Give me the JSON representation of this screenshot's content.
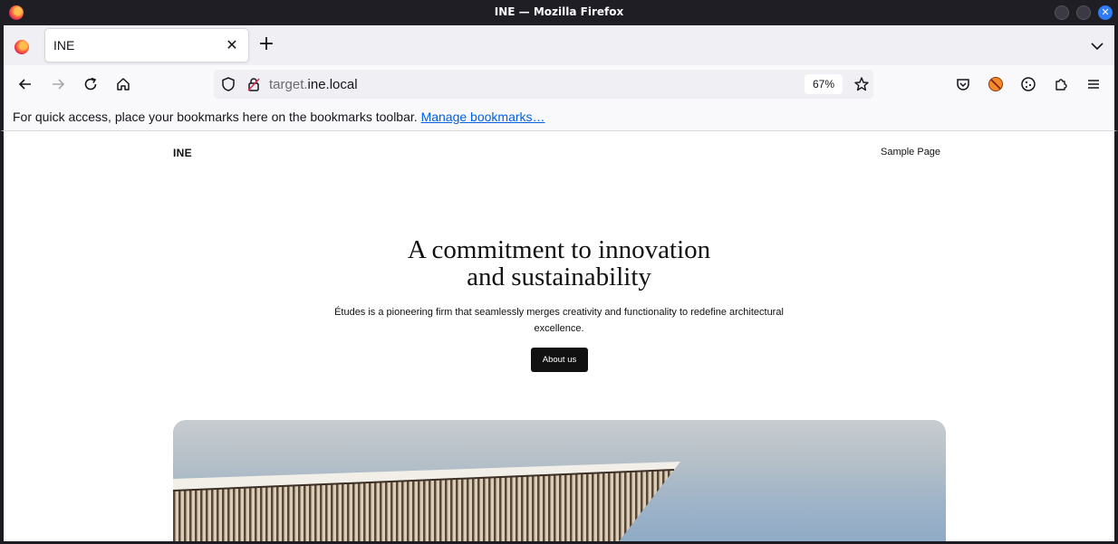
{
  "window": {
    "title": "INE — Mozilla Firefox"
  },
  "tabs": [
    {
      "label": "INE",
      "active": true
    }
  ],
  "toolbar": {
    "url_host_prefix": "target.",
    "url_host_domain": "ine.local",
    "zoom": "67%"
  },
  "bookmarks_bar": {
    "message": "For quick access, place your bookmarks here on the bookmarks toolbar.",
    "manage_link": "Manage bookmarks…"
  },
  "page": {
    "site_title": "INE",
    "nav_link": "Sample Page",
    "hero_title_line1": "A commitment to innovation",
    "hero_title_line2": "and sustainability",
    "hero_description": "Études is a pioneering firm that seamlessly merges creativity and functionality to redefine architectural excellence.",
    "cta_label": "About us"
  },
  "colors": {
    "accent_link": "#0061e0",
    "button_bg": "#111111",
    "window_close": "#2f7cf6"
  }
}
